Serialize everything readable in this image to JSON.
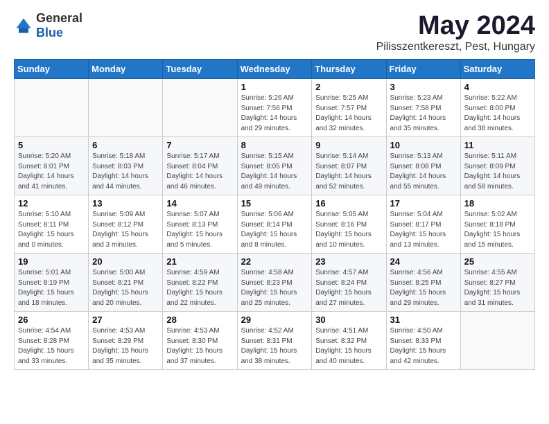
{
  "header": {
    "logo_general": "General",
    "logo_blue": "Blue",
    "title": "May 2024",
    "subtitle": "Pilisszentkereszt, Pest, Hungary"
  },
  "calendar": {
    "weekdays": [
      "Sunday",
      "Monday",
      "Tuesday",
      "Wednesday",
      "Thursday",
      "Friday",
      "Saturday"
    ],
    "weeks": [
      [
        {
          "day": "",
          "info": ""
        },
        {
          "day": "",
          "info": ""
        },
        {
          "day": "",
          "info": ""
        },
        {
          "day": "1",
          "info": "Sunrise: 5:26 AM\nSunset: 7:56 PM\nDaylight: 14 hours\nand 29 minutes."
        },
        {
          "day": "2",
          "info": "Sunrise: 5:25 AM\nSunset: 7:57 PM\nDaylight: 14 hours\nand 32 minutes."
        },
        {
          "day": "3",
          "info": "Sunrise: 5:23 AM\nSunset: 7:58 PM\nDaylight: 14 hours\nand 35 minutes."
        },
        {
          "day": "4",
          "info": "Sunrise: 5:22 AM\nSunset: 8:00 PM\nDaylight: 14 hours\nand 38 minutes."
        }
      ],
      [
        {
          "day": "5",
          "info": "Sunrise: 5:20 AM\nSunset: 8:01 PM\nDaylight: 14 hours\nand 41 minutes."
        },
        {
          "day": "6",
          "info": "Sunrise: 5:18 AM\nSunset: 8:03 PM\nDaylight: 14 hours\nand 44 minutes."
        },
        {
          "day": "7",
          "info": "Sunrise: 5:17 AM\nSunset: 8:04 PM\nDaylight: 14 hours\nand 46 minutes."
        },
        {
          "day": "8",
          "info": "Sunrise: 5:15 AM\nSunset: 8:05 PM\nDaylight: 14 hours\nand 49 minutes."
        },
        {
          "day": "9",
          "info": "Sunrise: 5:14 AM\nSunset: 8:07 PM\nDaylight: 14 hours\nand 52 minutes."
        },
        {
          "day": "10",
          "info": "Sunrise: 5:13 AM\nSunset: 8:08 PM\nDaylight: 14 hours\nand 55 minutes."
        },
        {
          "day": "11",
          "info": "Sunrise: 5:11 AM\nSunset: 8:09 PM\nDaylight: 14 hours\nand 58 minutes."
        }
      ],
      [
        {
          "day": "12",
          "info": "Sunrise: 5:10 AM\nSunset: 8:11 PM\nDaylight: 15 hours\nand 0 minutes."
        },
        {
          "day": "13",
          "info": "Sunrise: 5:09 AM\nSunset: 8:12 PM\nDaylight: 15 hours\nand 3 minutes."
        },
        {
          "day": "14",
          "info": "Sunrise: 5:07 AM\nSunset: 8:13 PM\nDaylight: 15 hours\nand 5 minutes."
        },
        {
          "day": "15",
          "info": "Sunrise: 5:06 AM\nSunset: 8:14 PM\nDaylight: 15 hours\nand 8 minutes."
        },
        {
          "day": "16",
          "info": "Sunrise: 5:05 AM\nSunset: 8:16 PM\nDaylight: 15 hours\nand 10 minutes."
        },
        {
          "day": "17",
          "info": "Sunrise: 5:04 AM\nSunset: 8:17 PM\nDaylight: 15 hours\nand 13 minutes."
        },
        {
          "day": "18",
          "info": "Sunrise: 5:02 AM\nSunset: 8:18 PM\nDaylight: 15 hours\nand 15 minutes."
        }
      ],
      [
        {
          "day": "19",
          "info": "Sunrise: 5:01 AM\nSunset: 8:19 PM\nDaylight: 15 hours\nand 18 minutes."
        },
        {
          "day": "20",
          "info": "Sunrise: 5:00 AM\nSunset: 8:21 PM\nDaylight: 15 hours\nand 20 minutes."
        },
        {
          "day": "21",
          "info": "Sunrise: 4:59 AM\nSunset: 8:22 PM\nDaylight: 15 hours\nand 22 minutes."
        },
        {
          "day": "22",
          "info": "Sunrise: 4:58 AM\nSunset: 8:23 PM\nDaylight: 15 hours\nand 25 minutes."
        },
        {
          "day": "23",
          "info": "Sunrise: 4:57 AM\nSunset: 8:24 PM\nDaylight: 15 hours\nand 27 minutes."
        },
        {
          "day": "24",
          "info": "Sunrise: 4:56 AM\nSunset: 8:25 PM\nDaylight: 15 hours\nand 29 minutes."
        },
        {
          "day": "25",
          "info": "Sunrise: 4:55 AM\nSunset: 8:27 PM\nDaylight: 15 hours\nand 31 minutes."
        }
      ],
      [
        {
          "day": "26",
          "info": "Sunrise: 4:54 AM\nSunset: 8:28 PM\nDaylight: 15 hours\nand 33 minutes."
        },
        {
          "day": "27",
          "info": "Sunrise: 4:53 AM\nSunset: 8:29 PM\nDaylight: 15 hours\nand 35 minutes."
        },
        {
          "day": "28",
          "info": "Sunrise: 4:53 AM\nSunset: 8:30 PM\nDaylight: 15 hours\nand 37 minutes."
        },
        {
          "day": "29",
          "info": "Sunrise: 4:52 AM\nSunset: 8:31 PM\nDaylight: 15 hours\nand 38 minutes."
        },
        {
          "day": "30",
          "info": "Sunrise: 4:51 AM\nSunset: 8:32 PM\nDaylight: 15 hours\nand 40 minutes."
        },
        {
          "day": "31",
          "info": "Sunrise: 4:50 AM\nSunset: 8:33 PM\nDaylight: 15 hours\nand 42 minutes."
        },
        {
          "day": "",
          "info": ""
        }
      ]
    ]
  }
}
